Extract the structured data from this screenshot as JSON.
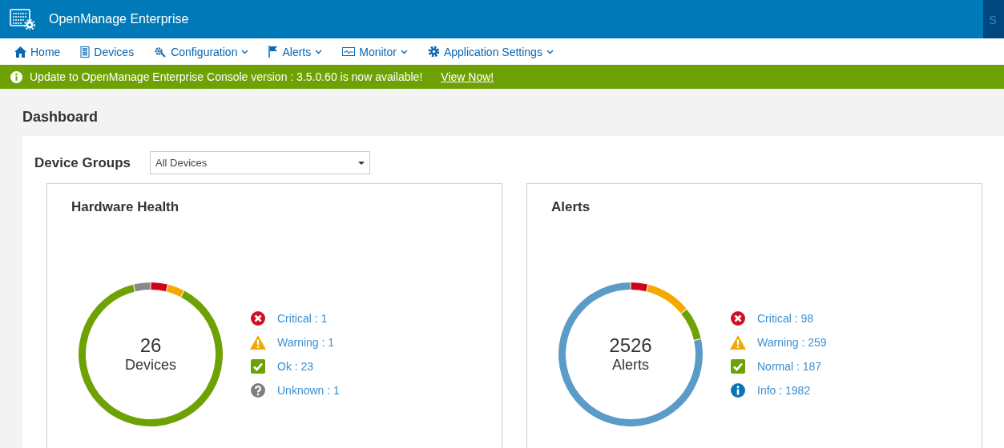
{
  "header": {
    "title": "OpenManage Enterprise",
    "right_button": "S"
  },
  "nav": [
    {
      "label": "Home",
      "dropdown": false
    },
    {
      "label": "Devices",
      "dropdown": false
    },
    {
      "label": "Configuration",
      "dropdown": true
    },
    {
      "label": "Alerts",
      "dropdown": true
    },
    {
      "label": "Monitor",
      "dropdown": true
    },
    {
      "label": "Application Settings",
      "dropdown": true
    }
  ],
  "banner": {
    "message": "Update to OpenManage Enterprise Console version : 3.5.0.60 is now available!",
    "link": "View Now!"
  },
  "page_title": "Dashboard",
  "device_groups": {
    "label": "Device Groups",
    "value": "All Devices"
  },
  "cards": [
    {
      "title": "Hardware Health",
      "total": "26",
      "legend": [
        {
          "kind": "critical"
        },
        {
          "kind": "warning"
        },
        {
          "kind": "ok"
        },
        {
          "kind": "unknown"
        }
      ],
      "chart_data": {
        "type": "donut",
        "categories": [
          "Critical : 1",
          "Warning : 1",
          "Ok : 23",
          "Unknown : 1"
        ],
        "series": [
          {
            "name": "Devices",
            "values": [
              1,
              1,
              23,
              1
            ]
          }
        ],
        "colors": [
          "#d0021b",
          "#f5a800",
          "#6ea204",
          "#888888"
        ]
      }
    },
    {
      "title": "Alerts",
      "total": "2526",
      "legend": [
        {
          "kind": "critical"
        },
        {
          "kind": "warning"
        },
        {
          "kind": "ok"
        },
        {
          "kind": "info"
        }
      ],
      "chart_data": {
        "type": "donut",
        "categories": [
          "Critical : 98",
          "Warning : 259",
          "Normal : 187",
          "Info : 1982"
        ],
        "series": [
          {
            "name": "Alerts",
            "values": [
              98,
              259,
              187,
              1982
            ]
          }
        ],
        "colors": [
          "#d0021b",
          "#f5a800",
          "#6ea204",
          "#5b9bc8"
        ]
      }
    }
  ]
}
